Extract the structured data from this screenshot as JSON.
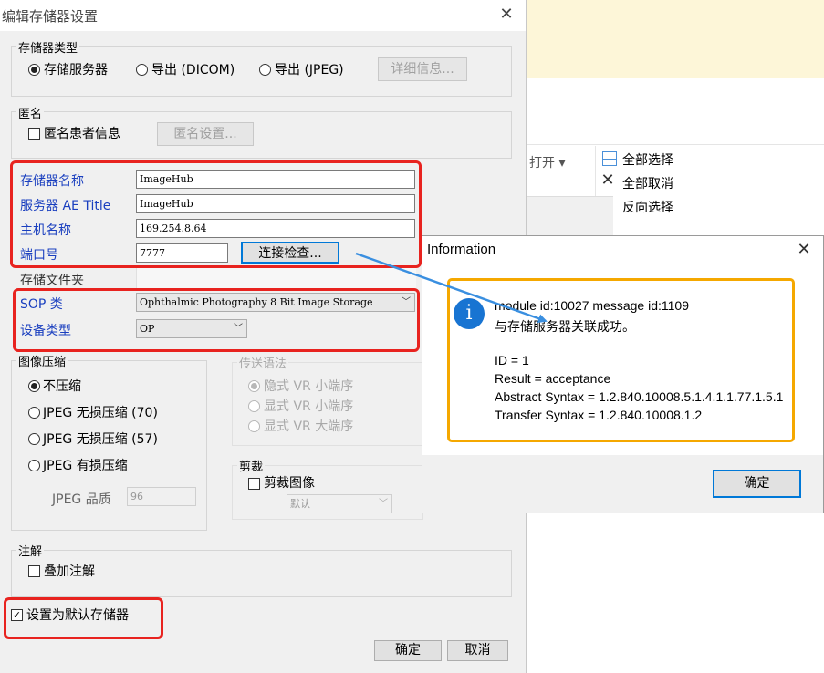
{
  "background_window": {
    "ribbon_open": "打开 ▾",
    "select_all": "全部选择",
    "select_none": "全部取消",
    "select_invert": "反向选择",
    "close_glyph": "✕"
  },
  "main_dialog": {
    "title": "编辑存储器设置",
    "close_glyph": "✕",
    "storage_type": {
      "label": "存储器类型",
      "options": [
        "存储服务器",
        "导出 (DICOM)",
        "导出 (JPEG)"
      ],
      "selected": "存储服务器",
      "details_button": "详细信息..."
    },
    "anonymize": {
      "label": "匿名",
      "checkbox_label": "匿名患者信息",
      "checked": false,
      "settings_button": "匿名设置..."
    },
    "connection": {
      "storage_name_label": "存储器名称",
      "storage_name_value": "ImageHub",
      "ae_title_label": "服务器 AE Title",
      "ae_title_value": "ImageHub",
      "host_label": "主机名称",
      "host_value": "169.254.8.64",
      "port_label": "端口号",
      "port_value": "7777",
      "check_button": "连接检查...",
      "folder_label": "存储文件夹"
    },
    "sop": {
      "sop_label": "SOP 类",
      "sop_value": "Ophthalmic Photography 8 Bit Image Storage",
      "device_label": "设备类型",
      "device_value": "OP"
    },
    "compression": {
      "label": "图像压缩",
      "options": [
        "不压缩",
        "JPEG 无损压缩 (70)",
        "JPEG 无损压缩 (57)",
        "JPEG 有损压缩"
      ],
      "selected": "不压缩",
      "quality_label": "JPEG 品质",
      "quality_value": "96"
    },
    "transfer": {
      "label": "传送语法",
      "options": [
        "隐式 VR 小端序",
        "显式 VR 小端序",
        "显式 VR 大端序"
      ],
      "selected": "隐式 VR 小端序"
    },
    "crop": {
      "label": "剪裁",
      "checkbox_label": "剪裁图像",
      "checked": false,
      "combo_value": "默认"
    },
    "annotation": {
      "label": "注解",
      "checkbox_label": "叠加注解",
      "checked": false
    },
    "default_checkbox_label": "设置为默认存储器",
    "default_checked": true,
    "ok_button": "确定",
    "cancel_button": "取消"
  },
  "info_dialog": {
    "title": "Information",
    "close_glyph": "✕",
    "icon_glyph": "i",
    "lines": [
      "module id:10027 message id:1109",
      "与存储服务器关联成功。",
      "ID = 1",
      "Result = acceptance",
      "Abstract Syntax = 1.2.840.10008.5.1.4.1.1.77.1.5.1",
      "Transfer Syntax = 1.2.840.10008.1.2"
    ],
    "ok_button": "确定"
  },
  "colors": {
    "highlight_red": "#e8231f",
    "highlight_orange": "#f5a800",
    "arrow_blue": "#3a8fe0",
    "label_blue": "#1a3fbf",
    "info_icon_blue": "#1874d2"
  }
}
